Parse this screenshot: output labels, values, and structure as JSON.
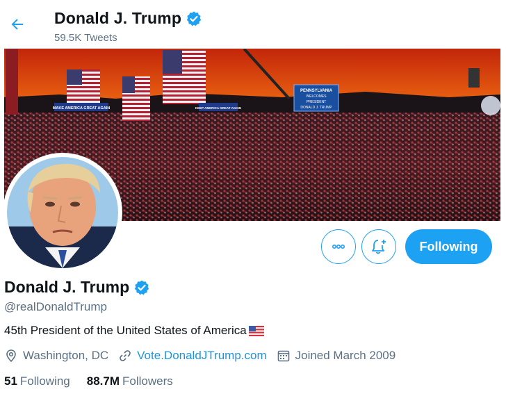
{
  "header": {
    "title": "Donald J. Trump",
    "tweet_count": "59.5K Tweets"
  },
  "banner": {
    "sign_main_line1": "PENNSYLVANIA",
    "sign_main_line2": "WELCOMES",
    "sign_main_line3": "PRESIDENT",
    "sign_main_line4": "DONALD J. TRUMP",
    "sign_left": "MAKE AMERICA GREAT AGAIN",
    "sign_mid": "KEEP AMERICA GREAT AGAIN"
  },
  "actions": {
    "more_icon": "more-horizontal-icon",
    "bell_icon": "notification-bell-plus-icon",
    "follow_label": "Following"
  },
  "profile": {
    "name": "Donald J. Trump",
    "handle": "@realDonaldTrump",
    "bio": "45th President of the United States of America",
    "location": "Washington, DC",
    "website": "Vote.DonaldJTrump.com",
    "joined": "Joined March 2009",
    "following_count": "51",
    "following_label": "Following",
    "followers_count": "88.7M",
    "followers_label": "Followers"
  },
  "colors": {
    "accent": "#1da1f2",
    "link": "#1b95e0",
    "secondary_text": "#5b7083"
  }
}
